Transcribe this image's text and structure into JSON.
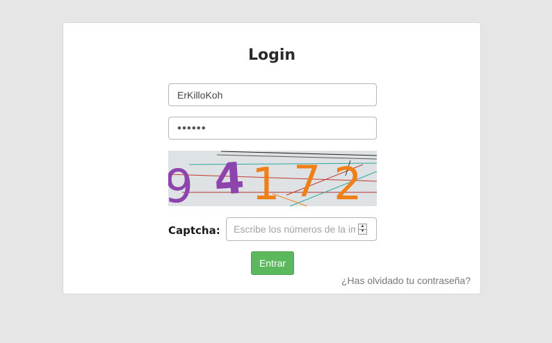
{
  "login": {
    "title": "Login",
    "username_value": "ErKilloKoh",
    "password_value": "••••••",
    "captcha_label": "Captcha:",
    "captcha_placeholder": "Escribe los números de la imagen",
    "captcha_digits": [
      "9",
      "4",
      "1",
      "7",
      "2"
    ],
    "submit_label": "Entrar",
    "forgot_label": "¿Has olvidado tu contraseña?"
  },
  "colors": {
    "page_bg": "#e6e6e6",
    "card_bg": "#ffffff",
    "button_green": "#5cb85c",
    "captcha_purple": "#8e44ad",
    "captcha_orange": "#f07f17"
  }
}
